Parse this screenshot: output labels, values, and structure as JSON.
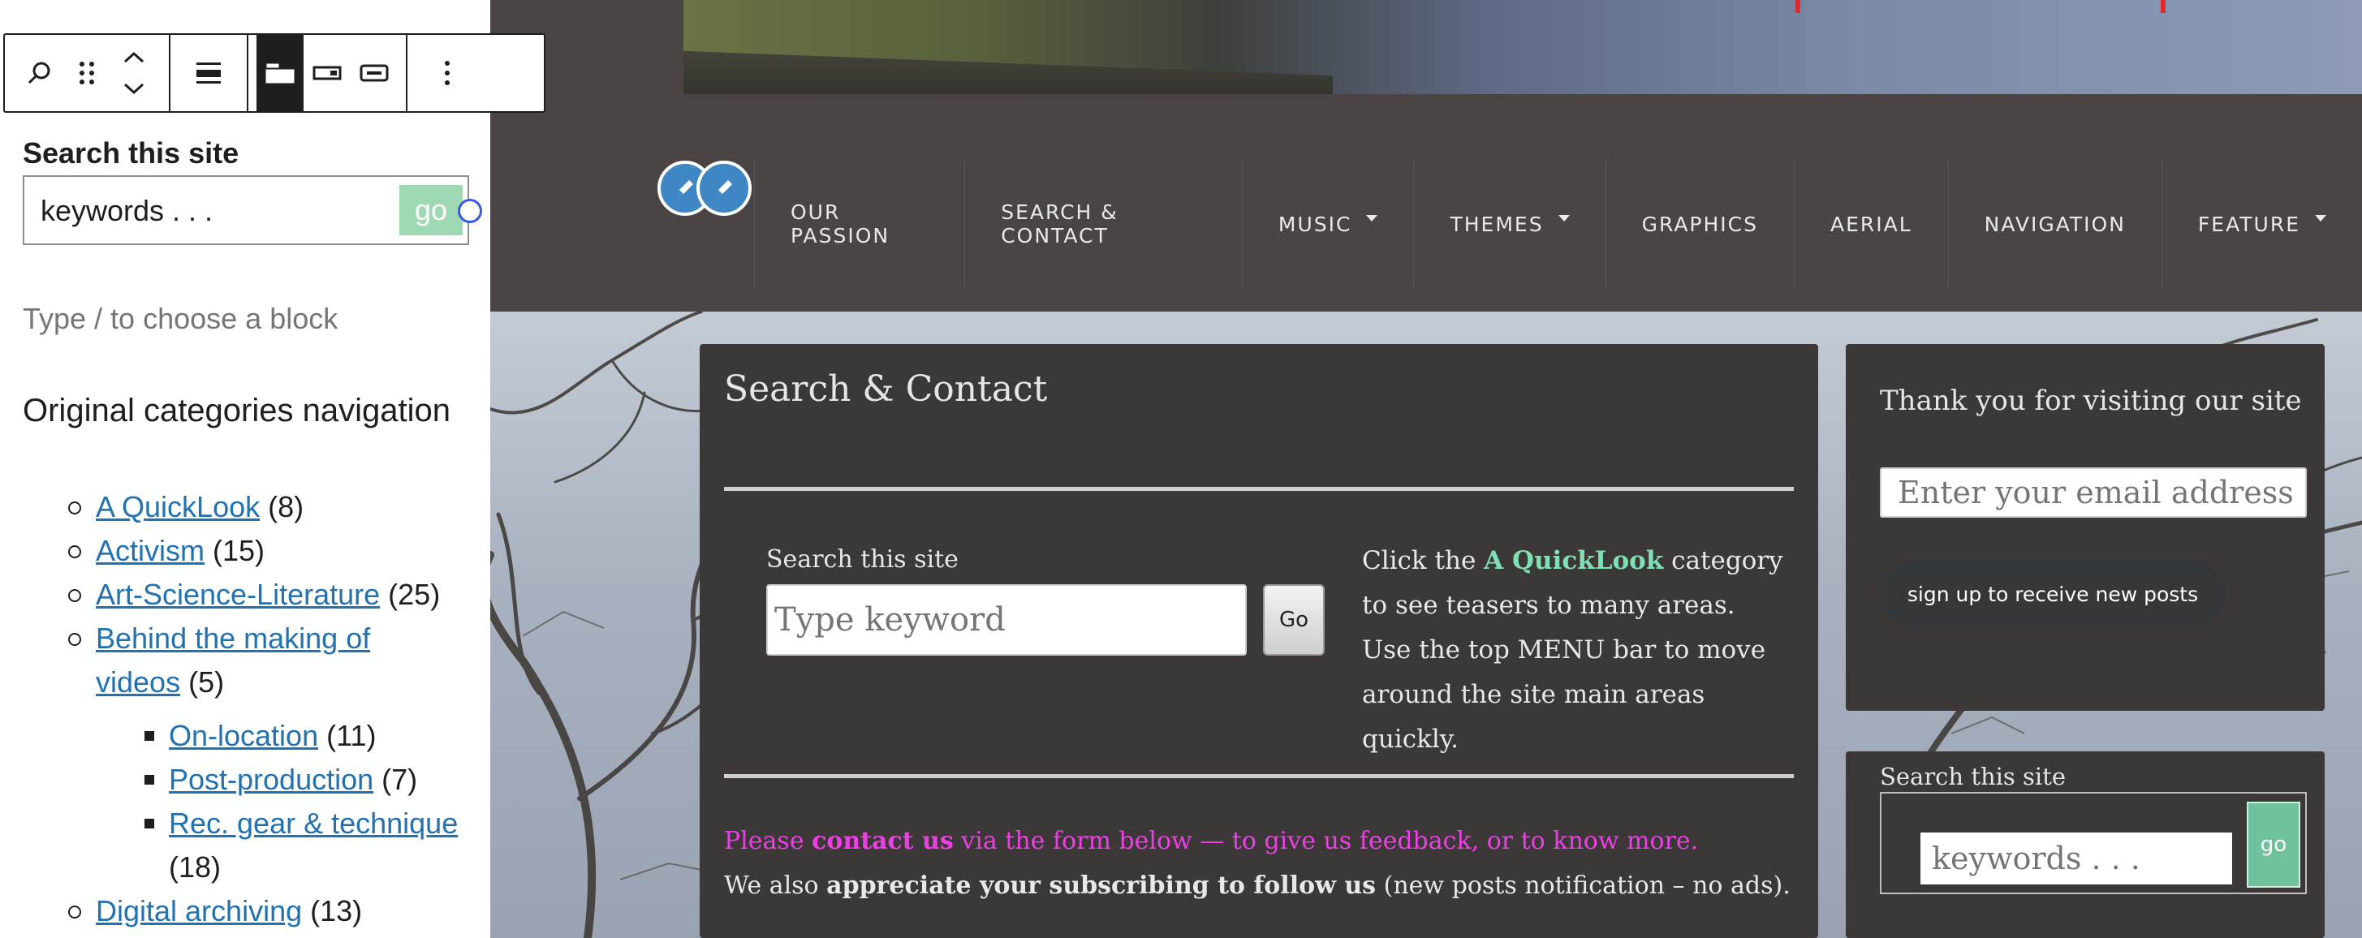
{
  "editor": {
    "toolbar": {
      "search_icon": "search-icon",
      "drag_icon": "drag-handle-icon",
      "move_icon": "move-up-down-icon",
      "align_icon": "align-center-icon"
    },
    "search_widget": {
      "title": "Search this site",
      "input_value": "keywords . . .",
      "go_label": "go"
    },
    "placeholder": "Type / to choose a block",
    "categories": {
      "heading": "Original categories navigation",
      "items": [
        {
          "label": "A QuickLook",
          "count": "(8)"
        },
        {
          "label": "Activism",
          "count": "(15)"
        },
        {
          "label": "Art-Science-Literature",
          "count": "(25)"
        },
        {
          "label": "Behind the making of videos",
          "count": "(5)"
        },
        {
          "label": "On-location",
          "count": "(11)"
        },
        {
          "label": "Post-production",
          "count": "(7)"
        },
        {
          "label": "Rec. gear & technique",
          "count": "(18)"
        },
        {
          "label": "Digital archiving",
          "count": "(13)"
        }
      ]
    }
  },
  "nav": {
    "items": [
      {
        "label": "OUR PASSION"
      },
      {
        "label": "SEARCH & CONTACT"
      },
      {
        "label": "MUSIC"
      },
      {
        "label": "THEMES"
      },
      {
        "label": "GRAPHICS"
      },
      {
        "label": "AERIAL"
      },
      {
        "label": "NAVIGATION"
      },
      {
        "label": "FEATURE"
      }
    ]
  },
  "main": {
    "title": "Search & Contact",
    "search_label": "Search this site",
    "search_placeholder": "Type keyword",
    "search_button": "Go",
    "info": {
      "pre": "Click the ",
      "highlight": "A QuickLook",
      "post": " category to see teasers to many areas. Use the top MENU bar to move around the site main areas quickly."
    },
    "contact": {
      "please": "Please ",
      "contact_us": "contact us",
      "rest": " via the form below — to give us feedback, or to know more.",
      "also": "We also ",
      "appreciate": "appreciate your subscribing to follow us",
      "tail": " (new posts notification – no ads)."
    }
  },
  "sidebar": {
    "subscribe": {
      "title": "Thank you for visiting our site",
      "email_placeholder": "Enter your email address",
      "button": "sign up to receive new posts"
    },
    "search": {
      "label": "Search this site",
      "placeholder": "keywords . . .",
      "go": "go"
    }
  },
  "colors": {
    "link": "#2271b1",
    "accent_green": "#7fe0b3",
    "magenta": "#ee3fe6",
    "site_dark": "#4a4544",
    "card_dark": "#3b3837"
  }
}
